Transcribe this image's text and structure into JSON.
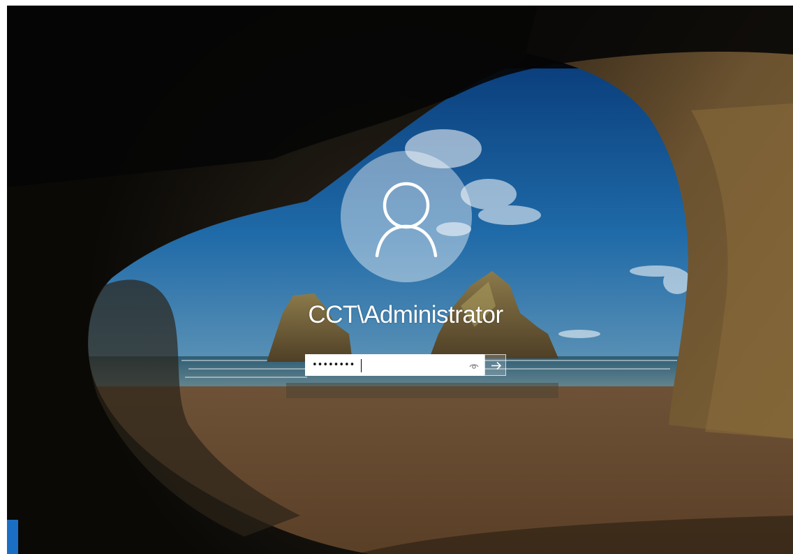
{
  "login": {
    "username": "CCT\\Administrator",
    "password_masked": "••••••••",
    "reveal_icon": "eye-icon",
    "submit_icon": "arrow-right-icon"
  },
  "avatar": {
    "icon": "user-silhouette-icon"
  },
  "colors": {
    "accent": "#1a6fc4",
    "field_background": "#ffffff",
    "text": "#ffffff"
  }
}
